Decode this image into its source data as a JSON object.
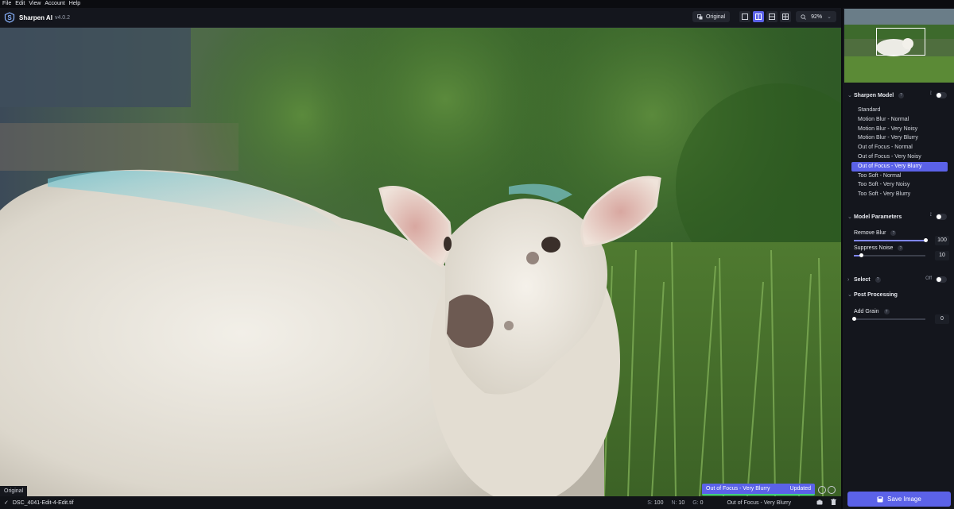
{
  "menu": [
    "File",
    "Edit",
    "View",
    "Account",
    "Help"
  ],
  "app": {
    "name": "Sharpen AI",
    "version": "v4.0.2"
  },
  "toolbar": {
    "original_label": "Original",
    "zoom": "92%"
  },
  "canvas": {
    "original_tag": "Original",
    "status_model": "Out of Focus - Very Blurry",
    "status_state": "Updated"
  },
  "bottom": {
    "filename": "DSC_4041-Edit-4-Edit.tif",
    "s_key": "S:",
    "s_val": "100",
    "n_key": "N:",
    "n_val": "10",
    "g_key": "G:",
    "g_val": "0",
    "model": "Out of Focus - Very Blurry"
  },
  "sidebar": {
    "sharpen_model": {
      "title": "Sharpen Model",
      "items": [
        "Standard",
        "Motion Blur - Normal",
        "Motion Blur - Very Noisy",
        "Motion Blur - Very Blurry",
        "Out of Focus - Normal",
        "Out of Focus - Very Noisy",
        "Out of Focus - Very Blurry",
        "Too Soft - Normal",
        "Too Soft - Very Noisy",
        "Too Soft - Very Blurry"
      ],
      "selected_index": 6
    },
    "model_parameters": {
      "title": "Model Parameters",
      "remove_blur": {
        "label": "Remove Blur",
        "value": "100",
        "level": 1.0
      },
      "suppress_noise": {
        "label": "Suppress Noise",
        "value": "10",
        "level": 0.1
      }
    },
    "select": {
      "title": "Select",
      "state": "Off"
    },
    "post_processing": {
      "title": "Post Processing",
      "add_grain": {
        "label": "Add Grain",
        "value": "0",
        "level": 0.0
      }
    },
    "save_label": "Save Image"
  },
  "colors": {
    "accent": "#5b62e8",
    "status_green": "#3fd07f"
  },
  "icons": [
    "sharpen-logo-icon",
    "compare-icon",
    "single-view-icon",
    "split-view-icon",
    "side-by-side-icon",
    "quad-view-icon",
    "zoom-icon",
    "check-icon",
    "camera-icon",
    "trash-icon",
    "save-icon",
    "help-icon",
    "pin-icon"
  ]
}
